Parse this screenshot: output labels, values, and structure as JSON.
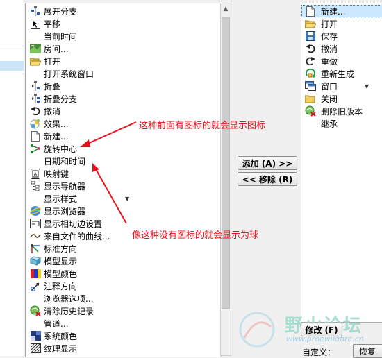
{
  "command_list": {
    "items": [
      {
        "label": "展开分支",
        "icon": "expand-branch-icon"
      },
      {
        "label": "平移",
        "icon": "pan-icon"
      },
      {
        "label": "当前时间",
        "icon": ""
      },
      {
        "label": "房间...",
        "icon": "room-icon"
      },
      {
        "label": "打开",
        "icon": "open-folder-icon"
      },
      {
        "label": "打开系统窗口",
        "icon": ""
      },
      {
        "label": "折叠",
        "icon": "collapse-icon"
      },
      {
        "label": "折叠分支",
        "icon": "collapse-branch-icon"
      },
      {
        "label": "撤消",
        "icon": "undo-icon"
      },
      {
        "label": "效果...",
        "icon": "effects-icon"
      },
      {
        "label": "新建...",
        "icon": "new-file-icon"
      },
      {
        "label": "旋转中心",
        "icon": "spin-center-icon"
      },
      {
        "label": "日期和时间",
        "icon": ""
      },
      {
        "label": "映射键",
        "icon": "mapkey-icon"
      },
      {
        "label": "显示导航器",
        "icon": "navigator-icon"
      },
      {
        "label": "显示样式",
        "icon": "",
        "has_dropdown": true
      },
      {
        "label": "显示浏览器",
        "icon": "browser-icon"
      },
      {
        "label": "显示相切边设置",
        "icon": "tangent-edge-icon"
      },
      {
        "label": "来自文件的曲线...",
        "icon": "curve-icon"
      },
      {
        "label": "标准方向",
        "icon": "standard-orientation-icon"
      },
      {
        "label": "模型显示",
        "icon": "model-display-icon"
      },
      {
        "label": "模型颜色",
        "icon": "model-color-icon"
      },
      {
        "label": "注释方向",
        "icon": "annotation-orientation-icon"
      },
      {
        "label": "浏览器选项...",
        "icon": ""
      },
      {
        "label": "清除历史记录",
        "icon": "clear-history-icon"
      },
      {
        "label": "管道...",
        "icon": ""
      },
      {
        "label": "系统颜色",
        "icon": "system-color-icon"
      },
      {
        "label": "纹理显示",
        "icon": "texture-icon"
      }
    ]
  },
  "buttons": {
    "add": "添加 (A) >>",
    "remove": "<< 移除 (R)",
    "modify": "修改 (F)",
    "restore": "恢复"
  },
  "toolbar_list": {
    "items": [
      {
        "label": "新建...",
        "icon": "new-file-icon",
        "selected": true
      },
      {
        "label": "打开",
        "icon": "open-folder-icon"
      },
      {
        "label": "保存",
        "icon": "save-icon"
      },
      {
        "label": "撤消",
        "icon": "undo-icon"
      },
      {
        "label": "重做",
        "icon": "redo-icon"
      },
      {
        "label": "重新生成",
        "icon": "regenerate-icon"
      },
      {
        "label": "窗口",
        "icon": "window-icon",
        "has_dropdown": true
      },
      {
        "label": "关闭",
        "icon": "close-folder-icon"
      },
      {
        "label": "删除旧版本",
        "icon": "erase-old-versions-icon"
      },
      {
        "label": "继承",
        "icon": ""
      }
    ]
  },
  "define_label": "自定义：",
  "annotations": {
    "top": "这种前面有图标的就会显示图标",
    "bottom": "像这种没有图标的就会显示为球"
  },
  "watermark": {
    "title": "野火论坛",
    "url": "www.proewildfire.cn"
  }
}
